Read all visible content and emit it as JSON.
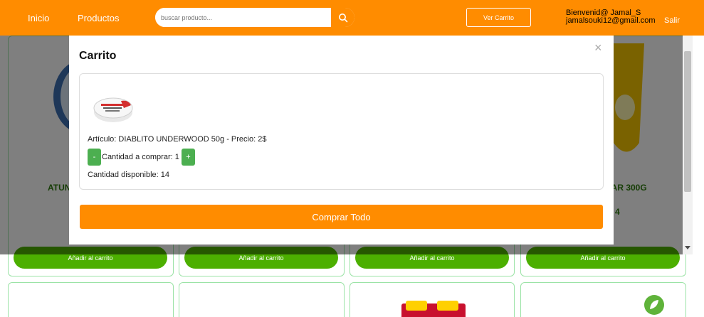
{
  "nav": {
    "home": "Inicio",
    "products": "Productos",
    "search_placeholder": "buscar producto...",
    "view_cart": "Ver Carrito",
    "welcome": "Bienvenid@ Jamal_S",
    "email": "jamalsouki12@gmail.com",
    "logout": "Salir"
  },
  "background": {
    "partial_title_left": "ATUN",
    "partial_title_right": "DAR 300G",
    "partial_price_right": "4",
    "add_to_cart_label": "Añadir al carrito"
  },
  "modal": {
    "title": "Carrito",
    "close_symbol": "×",
    "item": {
      "description": "Artículo: DIABLITO UNDERWOOD 50g - Precio: 2$",
      "minus": "-",
      "quantity_label": "Cantidad a comprar: 1",
      "plus": "+",
      "available": "Cantidad disponible: 14"
    },
    "buy_all": "Comprar Todo"
  },
  "colors": {
    "brand_orange": "#ff8c00",
    "add_green": "#4caf00",
    "qty_green": "#4caf50"
  }
}
